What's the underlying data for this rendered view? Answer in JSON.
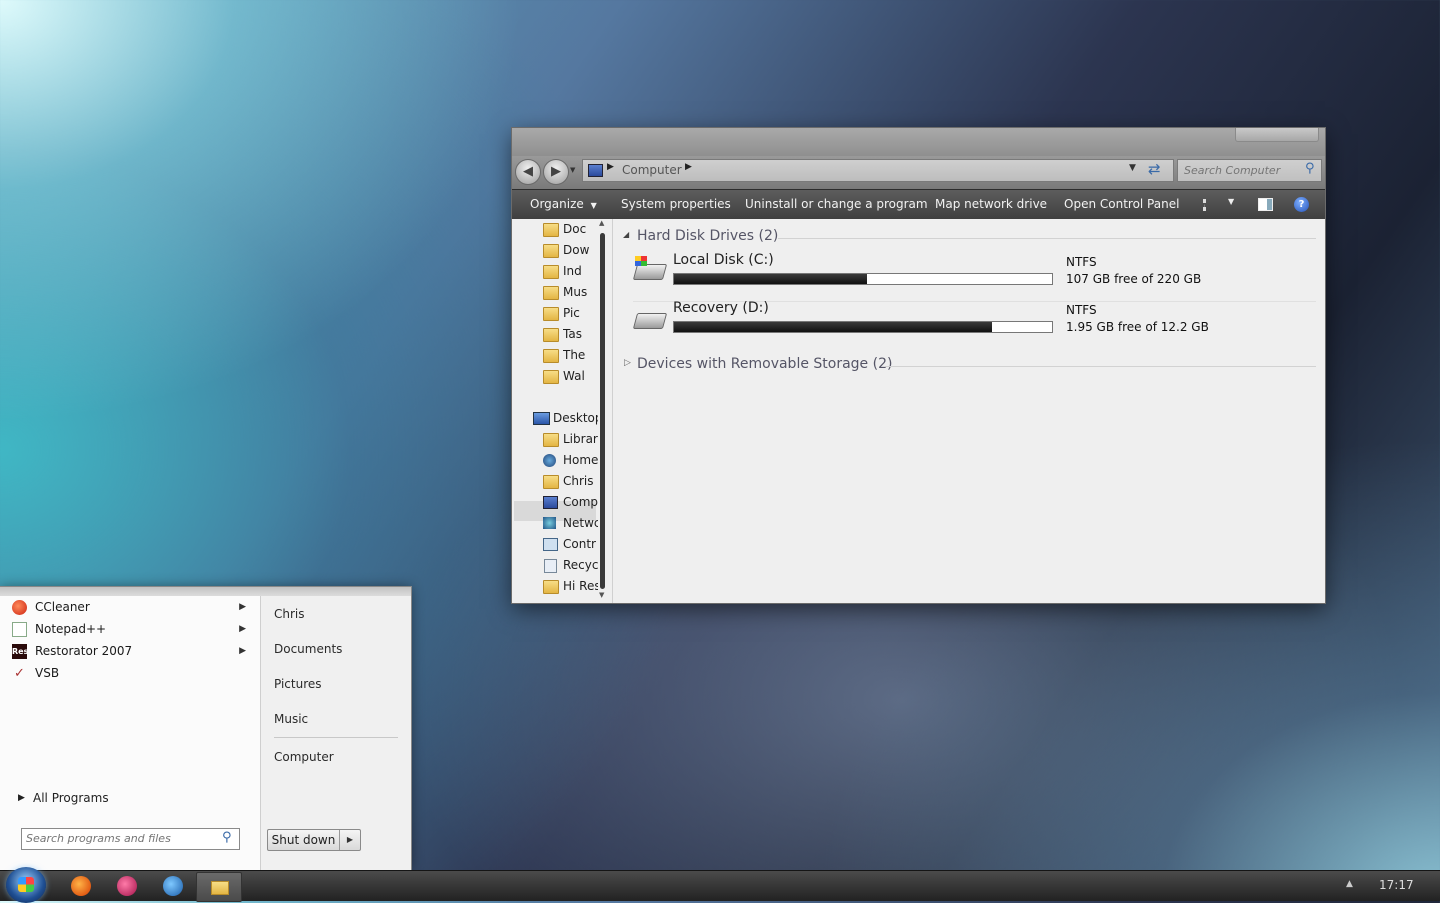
{
  "explorer": {
    "breadcrumb": "Computer",
    "search_placeholder": "Search Computer",
    "toolbar": {
      "organize": "Organize",
      "system_properties": "System properties",
      "uninstall": "Uninstall or change a program",
      "map_drive": "Map network drive",
      "control_panel": "Open Control Panel"
    },
    "nav_items": [
      "Doc",
      "Dow",
      "Ind",
      "Mus",
      "Pic",
      "Tas",
      "The",
      "Wal",
      "Desktop",
      "Librari",
      "Home",
      "Chris",
      "Comp",
      "Netwc",
      "Contr",
      "Recycl",
      "Hi Res"
    ],
    "groups": {
      "hdd_title": "Hard Disk Drives (2)",
      "removable_title": "Devices with Removable Storage (2)"
    },
    "drives": [
      {
        "name": "Local Disk (C:)",
        "fs": "NTFS",
        "free": "107 GB free of 220 GB",
        "used_fraction": 0.51
      },
      {
        "name": "Recovery (D:)",
        "fs": "NTFS",
        "free": "1.95 GB free of 12.2 GB",
        "used_fraction": 0.84
      }
    ]
  },
  "start_menu": {
    "programs": [
      {
        "label": "CCleaner",
        "has_arrow": true
      },
      {
        "label": "Notepad++",
        "has_arrow": true
      },
      {
        "label": "Restorator 2007",
        "has_arrow": true
      },
      {
        "label": "VSB",
        "has_arrow": false
      }
    ],
    "all_programs": "All Programs",
    "search_placeholder": "Search programs and files",
    "places": [
      "Chris",
      "Documents",
      "Pictures",
      "Music",
      "Computer"
    ],
    "shutdown": "Shut down",
    "restorator_icon_text": "Res"
  },
  "taskbar": {
    "clock": "17:17"
  },
  "colors": {
    "toolbar_bg": "#4a4a4a",
    "bar_fill": "#1a1a1a",
    "window_bg": "#efefef"
  }
}
